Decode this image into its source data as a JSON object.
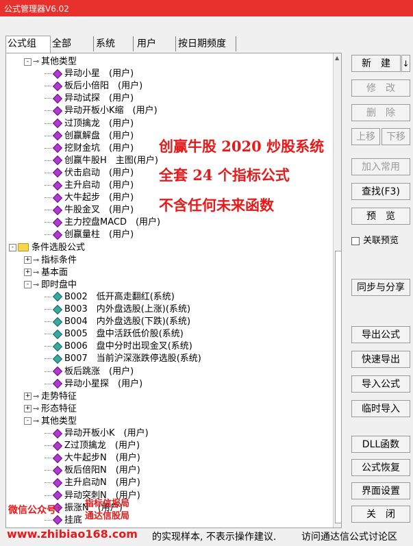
{
  "window": {
    "title": "公式管理器V6.02"
  },
  "tabs": [
    "公式组",
    "全部",
    "系统",
    "用户",
    "按日期频度"
  ],
  "tree": [
    {
      "text": "其他类型",
      "level": 1,
      "kind": "link",
      "exp": "-"
    },
    {
      "text": "异动小星　(用户)",
      "level": 2,
      "kind": "purple"
    },
    {
      "text": "板后小倍阳　(用户)",
      "level": 2,
      "kind": "purple"
    },
    {
      "text": "异动试探　(用户)",
      "level": 2,
      "kind": "purple"
    },
    {
      "text": "异动开板小K缩　(用户)",
      "level": 2,
      "kind": "purple"
    },
    {
      "text": "过顶擒龙　(用户)",
      "level": 2,
      "kind": "purple"
    },
    {
      "text": "创赢解盘　(用户)",
      "level": 2,
      "kind": "purple"
    },
    {
      "text": "挖财金坑　(用户)",
      "level": 2,
      "kind": "purple"
    },
    {
      "text": "创赢牛股H　主图(用户)",
      "level": 2,
      "kind": "purple"
    },
    {
      "text": "伏击启动　(用户)",
      "level": 2,
      "kind": "purple"
    },
    {
      "text": "主升启动　(用户)",
      "level": 2,
      "kind": "purple"
    },
    {
      "text": "大牛起步　(用户)",
      "level": 2,
      "kind": "purple"
    },
    {
      "text": "牛股金叉　(用户)",
      "level": 2,
      "kind": "purple"
    },
    {
      "text": "主力控盘MACD　(用户)",
      "level": 2,
      "kind": "purple"
    },
    {
      "text": "创赢量柱　(用户)",
      "level": 2,
      "kind": "purple"
    },
    {
      "text": "条件选股公式",
      "level": 0,
      "kind": "folder",
      "exp": "-"
    },
    {
      "text": "指标条件",
      "level": 1,
      "kind": "link",
      "exp": "+"
    },
    {
      "text": "基本面",
      "level": 1,
      "kind": "link",
      "exp": "+"
    },
    {
      "text": "即时盘中",
      "level": 1,
      "kind": "link",
      "exp": "-"
    },
    {
      "text": "B002　低开高走翻红(系统)",
      "level": 2,
      "kind": "teal"
    },
    {
      "text": "B003　内外盘选股(上涨)(系统)",
      "level": 2,
      "kind": "teal"
    },
    {
      "text": "B004　内外盘选股(下跌)(系统)",
      "level": 2,
      "kind": "teal"
    },
    {
      "text": "B005　盘中活跃低价股(系统)",
      "level": 2,
      "kind": "teal"
    },
    {
      "text": "B006　盘中分时出现金叉(系统)",
      "level": 2,
      "kind": "teal"
    },
    {
      "text": "B007　当前沪深涨跌停选股(系统)",
      "level": 2,
      "kind": "teal"
    },
    {
      "text": "板后跳涨　(用户)",
      "level": 2,
      "kind": "purple"
    },
    {
      "text": "异动小星探　(用户)",
      "level": 2,
      "kind": "purple"
    },
    {
      "text": "走势特征",
      "level": 1,
      "kind": "link",
      "exp": "+"
    },
    {
      "text": "形态特征",
      "level": 1,
      "kind": "link",
      "exp": "+"
    },
    {
      "text": "其他类型",
      "level": 1,
      "kind": "link",
      "exp": "-"
    },
    {
      "text": "异动开板小K　(用户)",
      "level": 2,
      "kind": "purple"
    },
    {
      "text": "Z过顶擒龙　(用户)",
      "level": 2,
      "kind": "purple"
    },
    {
      "text": "大牛起步N　(用户)",
      "level": 2,
      "kind": "purple"
    },
    {
      "text": "板后倍阳N　(用户)",
      "level": 2,
      "kind": "purple"
    },
    {
      "text": "主升启动N　(用户)",
      "level": 2,
      "kind": "purple"
    },
    {
      "text": "异动突刺N　(用户)",
      "level": 2,
      "kind": "purple"
    },
    {
      "text": "振涨N　(用户)",
      "level": 2,
      "kind": "purple"
    },
    {
      "text": "挂底",
      "level": 2,
      "kind": "purple"
    }
  ],
  "buttons": {
    "new": "新　建",
    "new_arrow": "↓",
    "modify": "修　改",
    "delete": "删　除",
    "move_up": "上移",
    "move_down": "下移",
    "add_common": "加入常用",
    "find": "查找(F3)",
    "preview": "预　览",
    "sync_share": "同步与分享",
    "export": "导出公式",
    "quick_export": "快速导出",
    "import": "导入公式",
    "temp_import": "临时导入",
    "dll": "DLL函数",
    "restore": "公式恢复",
    "ui_settings": "界面设置",
    "close": "关　闭"
  },
  "linked_preview": "关联预览",
  "overlay": {
    "line1": "创赢牛股 2020 炒股系统",
    "line2": "全套 24 个指标公式",
    "line3": "不含任何未来函数"
  },
  "watermark": {
    "wechat": "微信公众号：",
    "name1": "指标信报局",
    "name2": "通达信股局",
    "url": "www.zhibiao168.com"
  },
  "status": {
    "left": "的实现样本, 不表示操作建议.",
    "right": "访问通达信公式讨论区"
  }
}
